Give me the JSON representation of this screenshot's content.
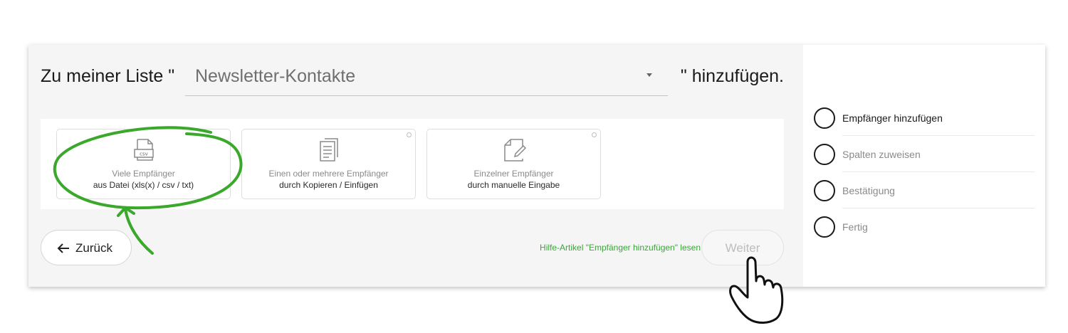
{
  "heading": {
    "prefix": "Zu meiner Liste \"",
    "suffix": "\" hinzufügen.",
    "list_value": "Newsletter-Kontakte"
  },
  "cards": [
    {
      "icon": "csv-file-icon",
      "icon_text": "csv",
      "line1": "Viele Empfänger",
      "line2": "aus Datei (xls(x) / csv / txt)"
    },
    {
      "icon": "copy-document-icon",
      "line1": "Einen oder mehrere Empfänger",
      "line2": "durch Kopieren / Einfügen"
    },
    {
      "icon": "edit-document-icon",
      "line1": "Einzelner Empfänger",
      "line2": "durch manuelle Eingabe"
    }
  ],
  "footer": {
    "back_label": "Zurück",
    "help_link": "Hilfe-Artikel \"Empfänger hinzufügen\" lesen",
    "next_label": "Weiter"
  },
  "steps": [
    {
      "label": "Empfänger hinzufügen",
      "active": true
    },
    {
      "label": "Spalten zuweisen",
      "active": false
    },
    {
      "label": "Bestätigung",
      "active": false
    },
    {
      "label": "Fertig",
      "active": false
    }
  ],
  "colors": {
    "accent_green": "#3aa53a",
    "annotation_green": "#3aa82a",
    "text_dark": "#1a1a1a",
    "text_muted": "#8a8a8a"
  }
}
